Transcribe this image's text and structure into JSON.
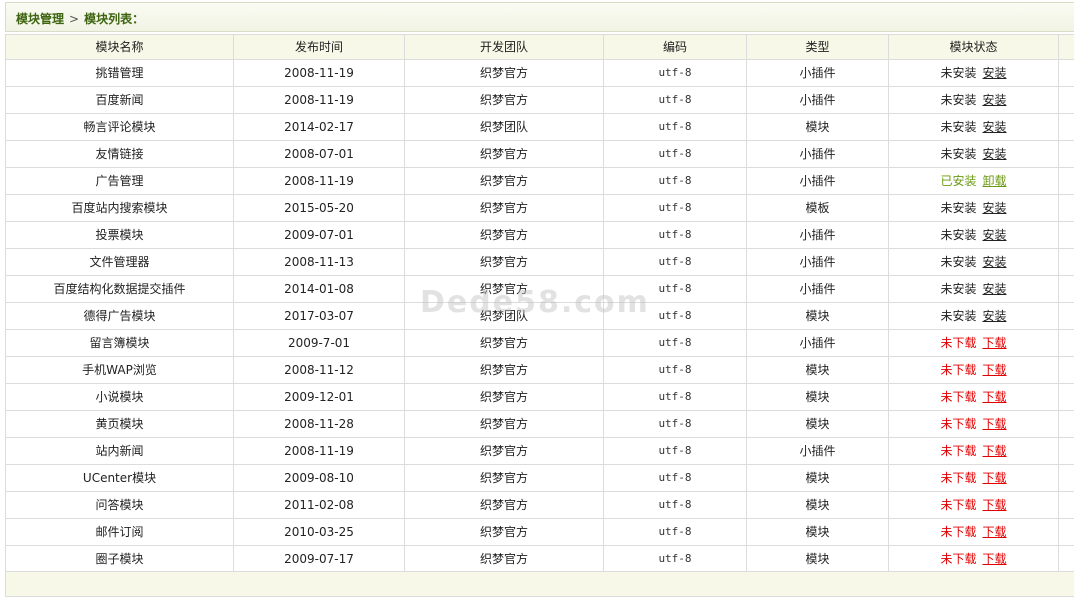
{
  "breadcrumb": {
    "root": "模块管理",
    "separator": ">",
    "current": "模块列表："
  },
  "table": {
    "columns": [
      "模块名称",
      "发布时间",
      "开发团队",
      "编码",
      "类型",
      "模块状态"
    ],
    "rows": [
      {
        "name": "挑错管理",
        "date": "2008-11-19",
        "team": "织梦官方",
        "encoding": "utf-8",
        "type": "小插件",
        "status": "未安装",
        "action": "安装",
        "state": "not_installed"
      },
      {
        "name": "百度新闻",
        "date": "2008-11-19",
        "team": "织梦官方",
        "encoding": "utf-8",
        "type": "小插件",
        "status": "未安装",
        "action": "安装",
        "state": "not_installed"
      },
      {
        "name": "畅言评论模块",
        "date": "2014-02-17",
        "team": "织梦团队",
        "encoding": "utf-8",
        "type": "模块",
        "status": "未安装",
        "action": "安装",
        "state": "not_installed"
      },
      {
        "name": "友情链接",
        "date": "2008-07-01",
        "team": "织梦官方",
        "encoding": "utf-8",
        "type": "小插件",
        "status": "未安装",
        "action": "安装",
        "state": "not_installed"
      },
      {
        "name": "广告管理",
        "date": "2008-11-19",
        "team": "织梦官方",
        "encoding": "utf-8",
        "type": "小插件",
        "status": "已安装",
        "action": "卸载",
        "state": "installed"
      },
      {
        "name": "百度站内搜索模块",
        "date": "2015-05-20",
        "team": "织梦官方",
        "encoding": "utf-8",
        "type": "模板",
        "status": "未安装",
        "action": "安装",
        "state": "not_installed"
      },
      {
        "name": "投票模块",
        "date": "2009-07-01",
        "team": "织梦官方",
        "encoding": "utf-8",
        "type": "小插件",
        "status": "未安装",
        "action": "安装",
        "state": "not_installed"
      },
      {
        "name": "文件管理器",
        "date": "2008-11-13",
        "team": "织梦官方",
        "encoding": "utf-8",
        "type": "小插件",
        "status": "未安装",
        "action": "安装",
        "state": "not_installed"
      },
      {
        "name": "百度结构化数据提交插件",
        "date": "2014-01-08",
        "team": "织梦官方",
        "encoding": "utf-8",
        "type": "小插件",
        "status": "未安装",
        "action": "安装",
        "state": "not_installed"
      },
      {
        "name": "德得广告模块",
        "date": "2017-03-07",
        "team": "织梦团队",
        "encoding": "utf-8",
        "type": "模块",
        "status": "未安装",
        "action": "安装",
        "state": "not_installed"
      },
      {
        "name": "留言簿模块",
        "date": "2009-7-01",
        "team": "织梦官方",
        "encoding": "utf-8",
        "type": "小插件",
        "status": "未下载",
        "action": "下载",
        "state": "not_downloaded"
      },
      {
        "name": "手机WAP浏览",
        "date": "2008-11-12",
        "team": "织梦官方",
        "encoding": "utf-8",
        "type": "模块",
        "status": "未下载",
        "action": "下载",
        "state": "not_downloaded"
      },
      {
        "name": "小说模块",
        "date": "2009-12-01",
        "team": "织梦官方",
        "encoding": "utf-8",
        "type": "模块",
        "status": "未下载",
        "action": "下载",
        "state": "not_downloaded"
      },
      {
        "name": "黄页模块",
        "date": "2008-11-28",
        "team": "织梦官方",
        "encoding": "utf-8",
        "type": "模块",
        "status": "未下载",
        "action": "下载",
        "state": "not_downloaded"
      },
      {
        "name": "站内新闻",
        "date": "2008-11-19",
        "team": "织梦官方",
        "encoding": "utf-8",
        "type": "小插件",
        "status": "未下载",
        "action": "下载",
        "state": "not_downloaded"
      },
      {
        "name": "UCenter模块",
        "date": "2009-08-10",
        "team": "织梦官方",
        "encoding": "utf-8",
        "type": "模块",
        "status": "未下载",
        "action": "下载",
        "state": "not_downloaded"
      },
      {
        "name": "问答模块",
        "date": "2011-02-08",
        "team": "织梦官方",
        "encoding": "utf-8",
        "type": "模块",
        "status": "未下载",
        "action": "下载",
        "state": "not_downloaded"
      },
      {
        "name": "邮件订阅",
        "date": "2010-03-25",
        "team": "织梦官方",
        "encoding": "utf-8",
        "type": "模块",
        "status": "未下载",
        "action": "下载",
        "state": "not_downloaded"
      },
      {
        "name": "圈子模块",
        "date": "2009-07-17",
        "team": "织梦官方",
        "encoding": "utf-8",
        "type": "模块",
        "status": "未下载",
        "action": "下载",
        "state": "not_downloaded"
      }
    ]
  },
  "watermark": "Dede58.com",
  "colors": {
    "installed": "#6b9a12",
    "not_downloaded": "#e30000",
    "breadcrumb": "#3d6410",
    "header_bg": "#f7f8e7"
  }
}
